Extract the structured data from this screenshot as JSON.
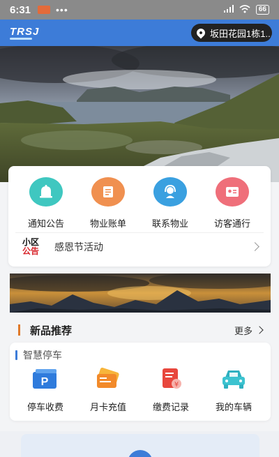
{
  "status_bar": {
    "time": "6:31",
    "battery": "66"
  },
  "header": {
    "logo": "TRSJ",
    "location": "坂田花园1栋1..."
  },
  "quick_actions": [
    {
      "label": "通知公告",
      "icon": "bell-icon",
      "color": "#3fc7c0"
    },
    {
      "label": "物业账单",
      "icon": "bill-icon",
      "color": "#f09050"
    },
    {
      "label": "联系物业",
      "icon": "headset-icon",
      "color": "#3aa0e0"
    },
    {
      "label": "访客通行",
      "icon": "id-card-icon",
      "color": "#ef6f7a"
    }
  ],
  "notice": {
    "tag_line1": "小区",
    "tag_line2": "公告",
    "text": "感恩节活动"
  },
  "section": {
    "title": "新品推荐",
    "more": "更多"
  },
  "parking": {
    "title": "智慧停车",
    "items": [
      {
        "label": "停车收费",
        "icon": "parking-icon"
      },
      {
        "label": "月卡充值",
        "icon": "card-icon"
      },
      {
        "label": "缴费记录",
        "icon": "receipt-icon"
      },
      {
        "label": "我的车辆",
        "icon": "car-icon"
      }
    ]
  },
  "colors": {
    "primary": "#3d7cd8",
    "accent": "#e07a2a",
    "red": "#d8262c"
  }
}
